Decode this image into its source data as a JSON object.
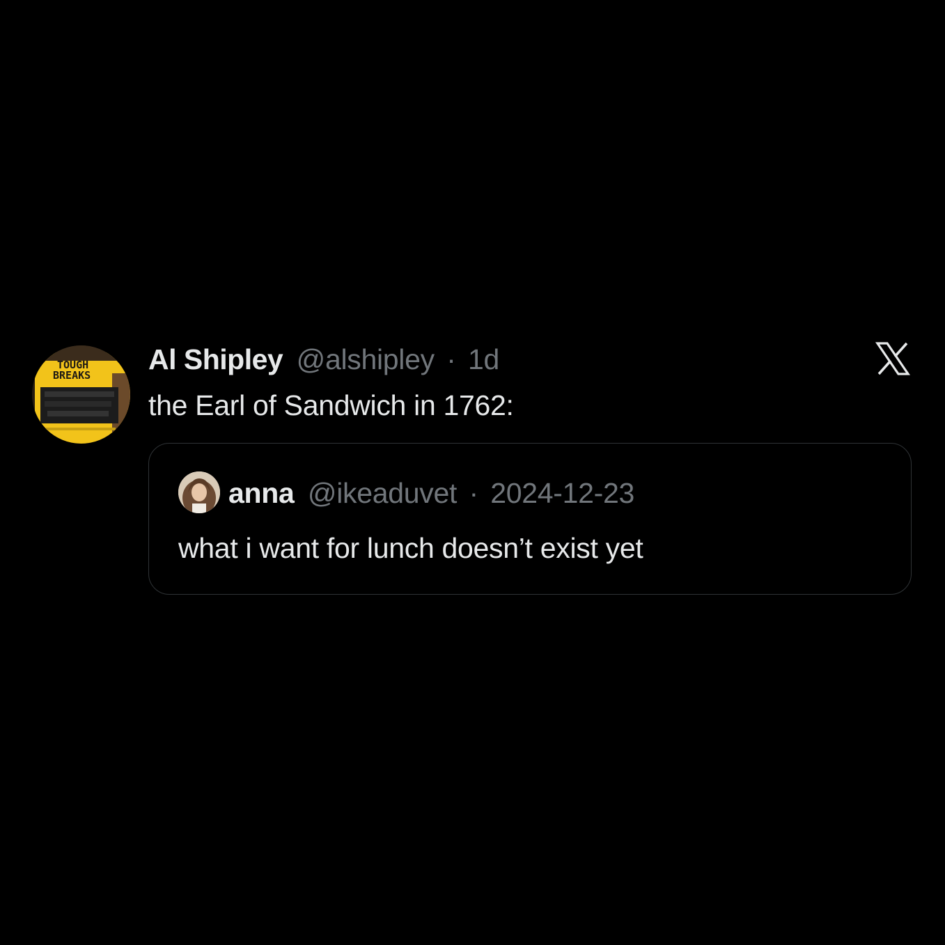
{
  "tweet": {
    "author": {
      "name": "Al Shipley",
      "handle": "@alshipley",
      "separator": "·",
      "time": "1d",
      "avatar_icon": "book-cover-avatar",
      "avatar_text": [
        "TOUGH",
        "BREAKS"
      ]
    },
    "text": "the Earl of Sandwich in 1762:",
    "platform_icon": "x-logo-icon",
    "quote": {
      "author": {
        "name": "anna",
        "handle": "@ikeaduvet",
        "separator": "·",
        "time": "2024-12-23",
        "avatar_icon": "user-photo-avatar"
      },
      "text": "what i want for lunch doesn’t exist yet"
    }
  },
  "colors": {
    "background": "#000000",
    "primary_text": "#e7e9ea",
    "secondary_text": "#71767b",
    "border": "#2f3336",
    "avatar_yellow": "#f2c31a"
  }
}
